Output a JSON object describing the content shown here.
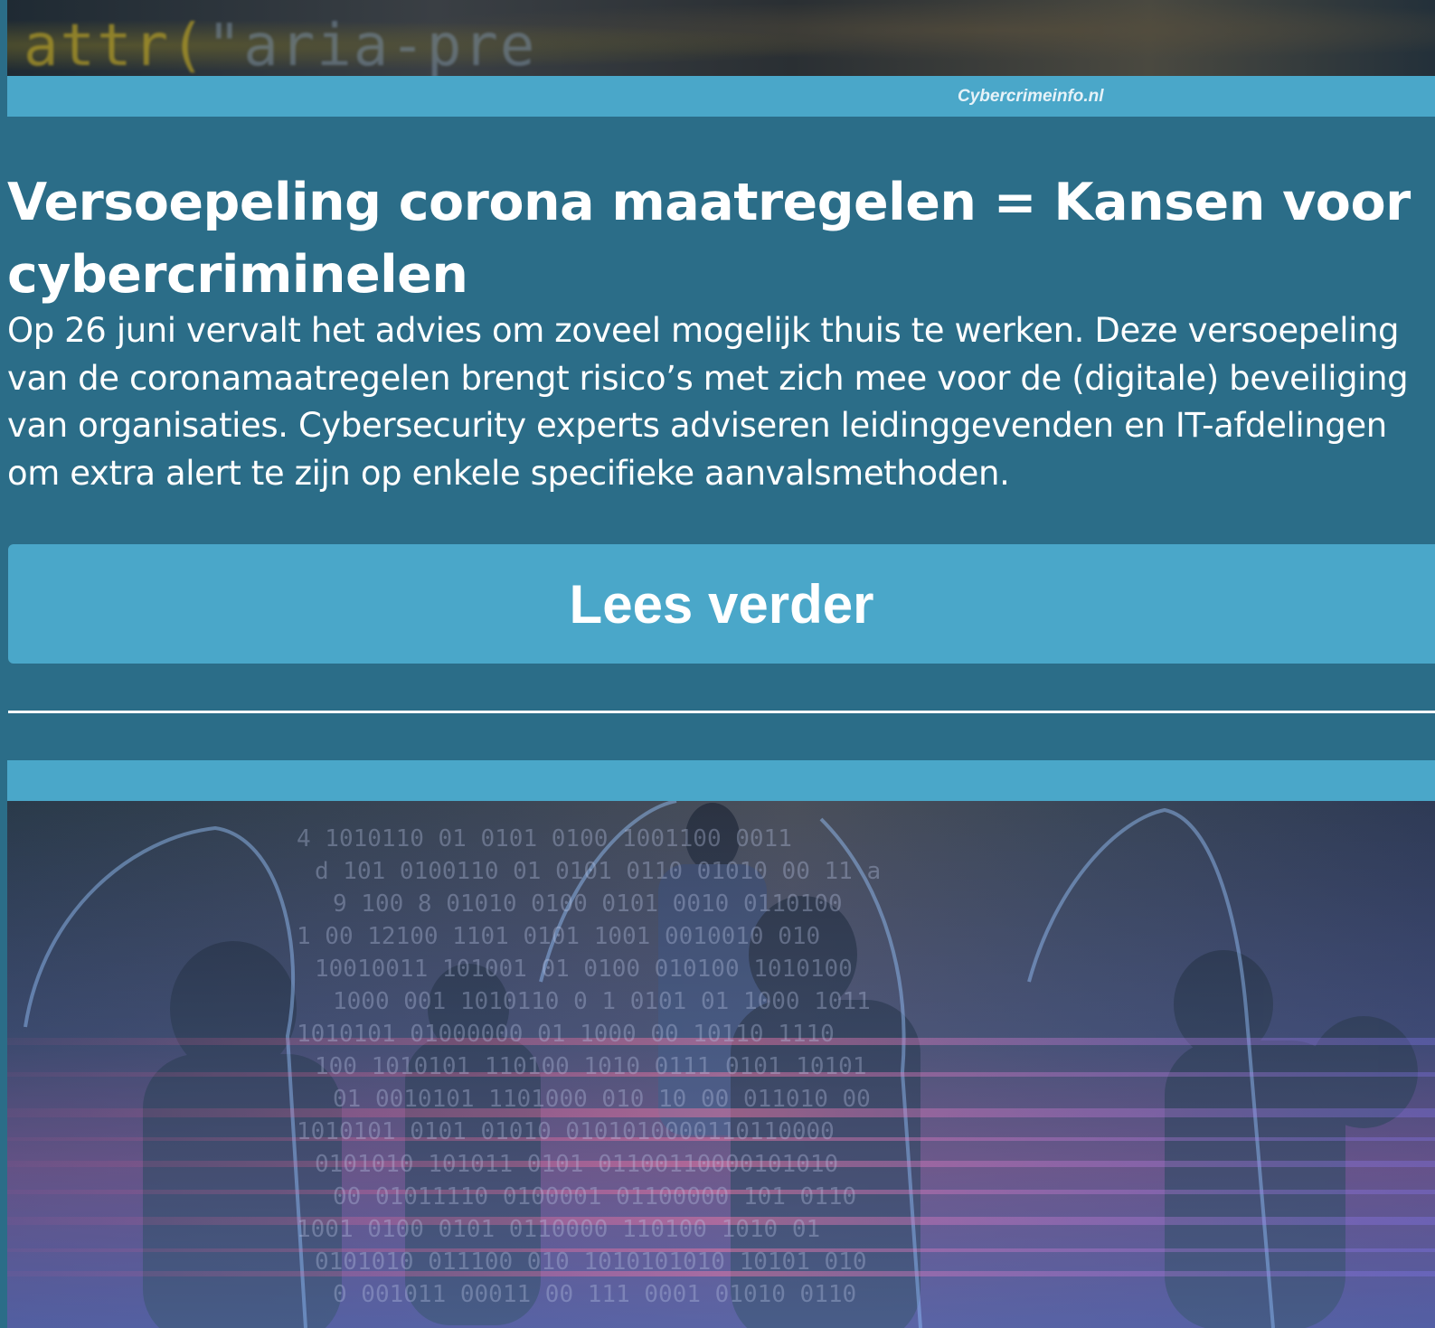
{
  "hero_top": {
    "code_prefix": "attr(",
    "code_text": "\"aria-pre"
  },
  "caption": "Cybercrimeinfo.nl",
  "article": {
    "title": "Versoepeling corona maatregelen = Kansen voor cybercriminelen",
    "intro": "Op 26 juni vervalt het advies om zoveel mogelijk thuis te werken. Deze versoepeling van de coronamaatregelen brengt risico’s met zich mee voor de (digitale) beveiliging van organisaties. Cybersecurity experts adviseren leidinggevenden en IT-afdelingen om extra alert te zijn op enkele specifieke aanvalsmethoden.",
    "read_more_label": "Lees verder"
  },
  "colors": {
    "background": "#2b6d88",
    "accent": "#4aa7c9",
    "text": "#ffffff"
  },
  "hero_bottom": {
    "binary_rows": [
      "4  1010110   01  0101 0100 1001100 0011",
      "d 101 0100110 01 0101 0110 01010 00 11 a",
      "9 100 8  01010 0100 0101 0010 0110100",
      "1 00 12100 1101 0101 1001 0010010 010",
      "10010011 101001 01 0100 010100 1010100",
      "1000 001 1010110 0 1 0101 01 1000 1011",
      "1010101 01000000 01 1000 00 10110 1110",
      "100 1010101 110100 1010 0111 0101 10101",
      "01 0010101 1101000 010 10 00 011010 00",
      "1010101 0101 01010 0101010000110110000",
      "0101010  101011 0101 01100110000101010",
      "00 01011110 0100001 01100000 101 0110",
      "1001 0100 0101 0110000 110100 1010 01",
      "0101010 011100 010 1010101010 10101 010",
      "0 001011 00011 00 111 0001 01010 0110"
    ]
  }
}
